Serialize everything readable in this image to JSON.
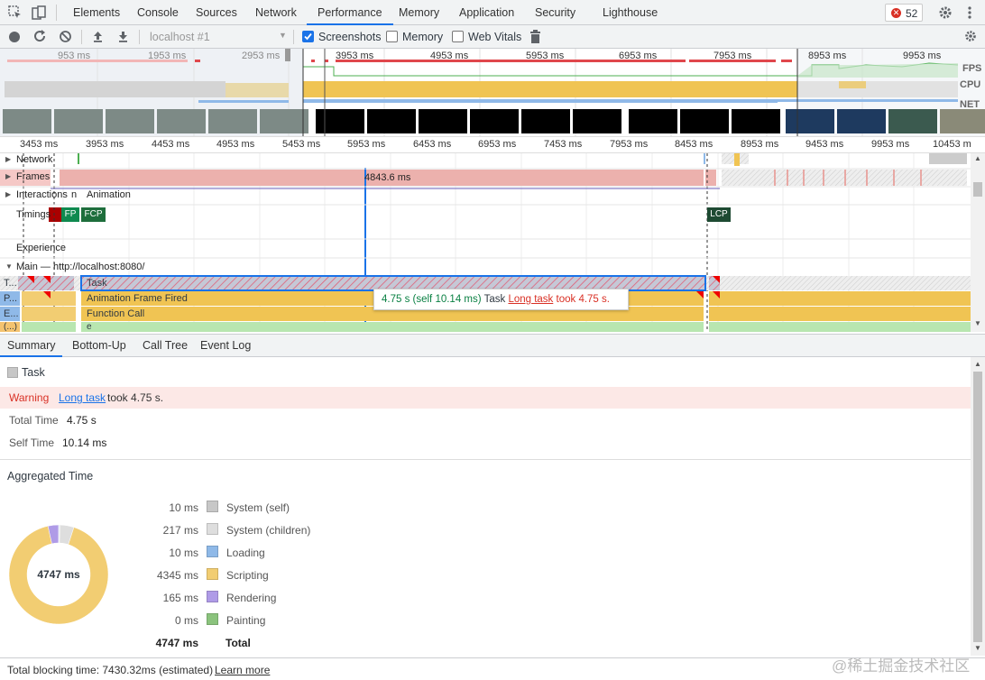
{
  "tabs": {
    "items": [
      "Elements",
      "Console",
      "Sources",
      "Network",
      "Performance",
      "Memory",
      "Application",
      "Security",
      "Lighthouse"
    ],
    "active": "Performance",
    "error_count": "52"
  },
  "toolbar": {
    "profile_select": "localhost #1",
    "screenshots_label": "Screenshots",
    "screenshots_checked": true,
    "memory_label": "Memory",
    "memory_checked": false,
    "web_vitals_label": "Web Vitals",
    "web_vitals_checked": false
  },
  "overview": {
    "ticks": [
      "953 ms",
      "1953 ms",
      "2953 ms",
      "3953 ms",
      "4953 ms",
      "5953 ms",
      "6953 ms",
      "7953 ms",
      "8953 ms",
      "9953 ms"
    ],
    "fps_label": "FPS",
    "cpu_label": "CPU",
    "net_label": "NET"
  },
  "ruler": {
    "ticks": [
      "3453 ms",
      "3953 ms",
      "4453 ms",
      "4953 ms",
      "5453 ms",
      "5953 ms",
      "6453 ms",
      "6953 ms",
      "7453 ms",
      "7953 ms",
      "8453 ms",
      "8953 ms",
      "9453 ms",
      "9953 ms",
      "10453 m"
    ]
  },
  "tracks": {
    "network": "Network",
    "frames": "Frames",
    "frame_duration": "4843.6 ms",
    "interactions": "Interactions",
    "interactions_sub": "n",
    "animation": "Animation",
    "timings": "Timings",
    "fp": "FP",
    "fcp": "FCP",
    "lcp": "LCP",
    "experience": "Experience",
    "main": "Main — http://localhost:8080/",
    "row_task_short": "T...",
    "row_p_short": "P...",
    "row_e_short": "E...",
    "row_anon_short": "(...)",
    "task": "Task",
    "animation_frame": "Animation Frame Fired",
    "function_call": "Function Call",
    "e_call": "e"
  },
  "tooltip": {
    "time": "4.75 s (self 10.14 ms)",
    "name": "Task",
    "link": "Long task",
    "rest": "took 4.75 s."
  },
  "bottom_tabs": {
    "items": [
      "Summary",
      "Bottom-Up",
      "Call Tree",
      "Event Log"
    ],
    "active": "Summary"
  },
  "summary": {
    "title": "Task",
    "warning_label": "Warning",
    "warning_link": "Long task",
    "warning_rest": "took 4.75 s.",
    "total_time_label": "Total Time",
    "total_time": "4.75 s",
    "self_time_label": "Self Time",
    "self_time": "10.14 ms",
    "aggregated_title": "Aggregated Time",
    "donut_center": "4747 ms",
    "rows": [
      {
        "value": "10 ms",
        "label": "System (self)",
        "color": "#c7c7c7",
        "ms": 10
      },
      {
        "value": "217 ms",
        "label": "System (children)",
        "color": "#dedede",
        "ms": 217
      },
      {
        "value": "10 ms",
        "label": "Loading",
        "color": "#8fb9e8",
        "ms": 10
      },
      {
        "value": "4345 ms",
        "label": "Scripting",
        "color": "#f2cd72",
        "ms": 4345
      },
      {
        "value": "165 ms",
        "label": "Rendering",
        "color": "#af9be7",
        "ms": 165
      },
      {
        "value": "0 ms",
        "label": "Painting",
        "color": "#8bc37d",
        "ms": 0
      }
    ],
    "total_value": "4747 ms",
    "total_label": "Total"
  },
  "status": {
    "text": "Total blocking time: 7430.32ms (estimated)",
    "link": "Learn more",
    "watermark": "@稀土掘金技术社区"
  }
}
